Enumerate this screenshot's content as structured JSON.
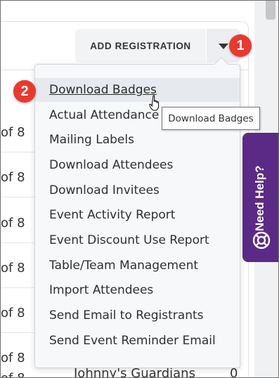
{
  "header": {
    "add_registration_label": "ADD REGISTRATION",
    "dropdown_toggle_icon": "caret-down-icon"
  },
  "background_rows": [
    {
      "text": "of 8"
    },
    {
      "text": "of 8"
    },
    {
      "text": "of 8"
    },
    {
      "text": "of 8"
    },
    {
      "text": "of 8"
    },
    {
      "text": "of 8"
    },
    {
      "text": "of 8"
    }
  ],
  "background_bottom": {
    "text": "Johnny's Guardians",
    "number": "0"
  },
  "menu": {
    "items": [
      {
        "label": "Download Badges",
        "active": true
      },
      {
        "label": "Actual Attendance"
      },
      {
        "label": "Mailing Labels"
      },
      {
        "label": "Download Attendees"
      },
      {
        "label": "Download Invitees"
      },
      {
        "label": "Event Activity Report"
      },
      {
        "label": "Event Discount Use Report"
      },
      {
        "label": "Table/Team Management"
      },
      {
        "label": "Import Attendees"
      },
      {
        "label": "Send Email to Registrants"
      },
      {
        "label": "Send Event Reminder Email"
      }
    ]
  },
  "tooltip": {
    "text": "Download Badges"
  },
  "callouts": {
    "step1": "1",
    "step2": "2",
    "color": "#e8392f"
  },
  "help": {
    "label": "Need Help?",
    "icon": "lifebuoy-icon",
    "color": "#5b2a86"
  }
}
